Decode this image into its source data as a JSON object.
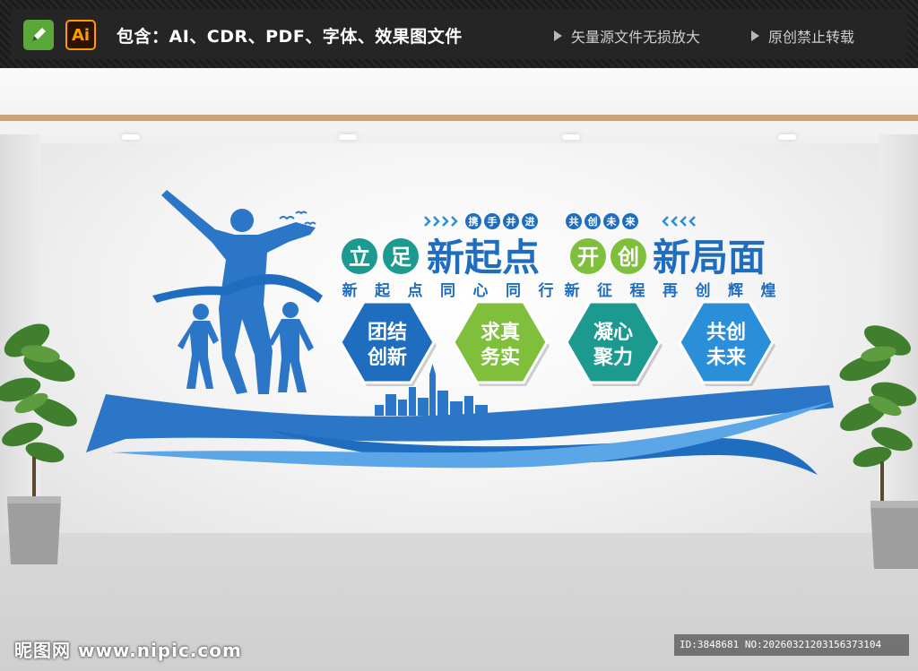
{
  "banner": {
    "contains": "包含：AI、CDR、PDF、字体、效果图文件",
    "note1": "矢量源文件无损放大",
    "note2": "原创禁止转载",
    "ai_label": "Ai"
  },
  "wall": {
    "tag_left": "携手并进",
    "tag_right": "共创未来",
    "headline_a_chars": [
      "立",
      "足"
    ],
    "headline_a_rest": "新起点",
    "headline_b_chars": [
      "开",
      "创"
    ],
    "headline_b_rest": "新局面",
    "subline_left": [
      "新",
      "起",
      "点",
      "同",
      "心",
      "同",
      "行"
    ],
    "subline_right": [
      "新",
      "征",
      "程",
      "再",
      "创",
      "辉",
      "煌"
    ],
    "hexagons": [
      {
        "line1": "团结",
        "line2": "创新",
        "color": "#1f6dbf"
      },
      {
        "line1": "求真",
        "line2": "务实",
        "color": "#7fbf3c"
      },
      {
        "line1": "凝心",
        "line2": "聚力",
        "color": "#1c9a8f"
      },
      {
        "line1": "共创",
        "line2": "未来",
        "color": "#2a8fd8"
      }
    ],
    "colors": {
      "blue": "#1f6dbf",
      "light_blue": "#2a8fd8",
      "green": "#7fbf3c",
      "teal": "#1c9a8f"
    }
  },
  "watermark": {
    "site": "昵图网 www.nipic.com",
    "id_line": "ID:3848681 NO:20260321203156373104"
  }
}
